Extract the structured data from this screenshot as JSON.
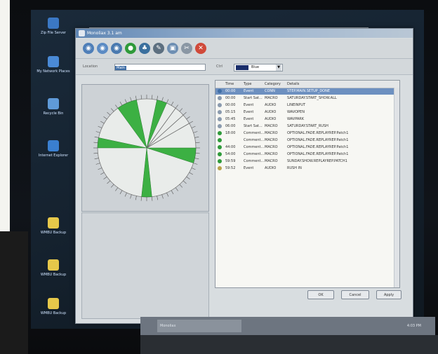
{
  "desktop": {
    "icons": [
      {
        "label": "Zip File Server",
        "icon": "server-icon",
        "color": "#3b78c4"
      },
      {
        "label": "My Network Places",
        "icon": "network-icon",
        "color": "#4a8ad6"
      },
      {
        "label": "Recycle Bin",
        "icon": "recycle-bin-icon",
        "color": "#5f9ad8"
      },
      {
        "label": "Internet Explorer",
        "icon": "ie-icon",
        "color": "#3a7fd0"
      },
      {
        "label": "WMBU Backup",
        "icon": "folder-icon",
        "color": "#e6c84a"
      },
      {
        "label": "WMBU Backup",
        "icon": "folder-icon",
        "color": "#e6c84a"
      },
      {
        "label": "WMBU Backup",
        "icon": "folder-icon",
        "color": "#e6c84a"
      }
    ]
  },
  "window": {
    "title": "Monoliax 3.1 am",
    "toolbar_icons": [
      {
        "name": "open-icon",
        "glyph": "◉",
        "color": "#4f7fb8"
      },
      {
        "name": "save-icon",
        "glyph": "◉",
        "color": "#5b8bc4"
      },
      {
        "name": "refresh-icon",
        "glyph": "◉",
        "color": "#4a7ab0"
      },
      {
        "name": "add-icon",
        "glyph": "●",
        "color": "#2e9a3a"
      },
      {
        "name": "users-icon",
        "glyph": "♣",
        "color": "#3a6f9e"
      },
      {
        "name": "edit-icon",
        "glyph": "✎",
        "color": "#5c6f80"
      },
      {
        "name": "copy-icon",
        "glyph": "▣",
        "color": "#6e8fb3"
      },
      {
        "name": "cut-icon",
        "glyph": "✂",
        "color": "#8a97a4"
      },
      {
        "name": "delete-icon",
        "glyph": "✕",
        "color": "#d04a3a"
      }
    ],
    "filter": {
      "location_label": "Location",
      "location_value": "Main",
      "ctrl_label": "Ctrl",
      "ctrl_value": "Blue"
    },
    "list": {
      "columns": [
        "",
        "Time",
        "Type",
        "Category",
        "Details"
      ],
      "rows": [
        {
          "icon_color": "#3f6ea6",
          "time": "00:00",
          "type": "Event",
          "category": "CONN",
          "details": "STEP.MAIN.SETUP_DONE",
          "selected": true
        },
        {
          "icon_color": "#8a9aae",
          "time": "00:00",
          "type": "Start Sat...",
          "category": "MACRO",
          "details": "SATURDAY.START_SHOW.ALL",
          "selected": false
        },
        {
          "icon_color": "#8a9aae",
          "time": "00:00",
          "type": "Event",
          "category": "AUDIO",
          "details": "LINEINPUT",
          "selected": false
        },
        {
          "icon_color": "#8a9aae",
          "time": "05:15",
          "type": "Event",
          "category": "AUDIO",
          "details": "WAVOPEN",
          "selected": false
        },
        {
          "icon_color": "#8a9aae",
          "time": "05:45",
          "type": "Event",
          "category": "AUDIO",
          "details": "WAVPARK",
          "selected": false
        },
        {
          "icon_color": "#8a9aae",
          "time": "06:00",
          "type": "Start Sat...",
          "category": "MACRO",
          "details": "SATURDAY.START_RUSH",
          "selected": false
        },
        {
          "icon_color": "#2e9a3a",
          "time": "18:00",
          "type": "Comment...",
          "category": "MACRO",
          "details": "OPTIONAL.FADE.REPLAYREP.Patch1",
          "selected": false
        },
        {
          "icon_color": "#2e9a3a",
          "time": "",
          "type": "Comment...",
          "category": "MACRO",
          "details": "OPTIONAL.FADE.REPLAYREP.Patch1",
          "selected": false
        },
        {
          "icon_color": "#2e9a3a",
          "time": "44:00",
          "type": "Comment...",
          "category": "MACRO",
          "details": "OPTIONAL.FADE.REPLAYREP.Patch1",
          "selected": false
        },
        {
          "icon_color": "#2e9a3a",
          "time": "54:00",
          "type": "Comment...",
          "category": "MACRO",
          "details": "OPTIONAL.FADE.REPLAYREP.Patch1",
          "selected": false
        },
        {
          "icon_color": "#2e9a3a",
          "time": "59:59",
          "type": "Comment...",
          "category": "MACRO",
          "details": "SUNDAY.SHOW.REPLAYREP.PATCH1",
          "selected": false
        },
        {
          "icon_color": "#b8a24a",
          "time": "59:52",
          "type": "Event",
          "category": "AUDIO",
          "details": "RUSH IN",
          "selected": false
        }
      ]
    },
    "buttons": {
      "ok": "OK",
      "cancel": "Cancel",
      "apply": "Apply"
    }
  },
  "clock_chart": {
    "wedge_color": "#3cb043",
    "line_color": "#666666",
    "wedges": [
      {
        "start_min": 2,
        "end_min": 4
      },
      {
        "start_min": 54,
        "end_min": 58
      },
      {
        "start_min": 15,
        "end_min": 18
      },
      {
        "start_min": 45,
        "end_min": 47
      },
      {
        "start_min": 29,
        "end_min": 31
      }
    ],
    "lines_min": [
      6,
      8,
      10
    ]
  },
  "taskbar": {
    "task_label": "Monoliax",
    "clock": "4:03 PM"
  }
}
